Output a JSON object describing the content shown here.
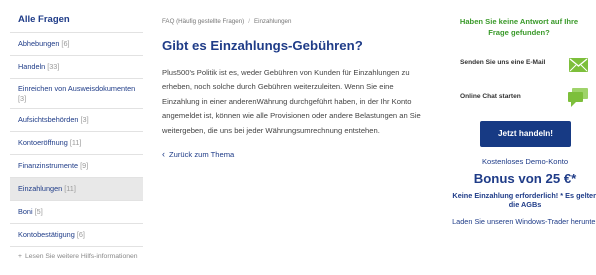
{
  "sidebar": {
    "title": "Alle Fragen",
    "items": [
      {
        "label": "Abhebungen",
        "count": "[6]"
      },
      {
        "label": "Handeln",
        "count": "[33]"
      },
      {
        "label": "Einreichen von Ausweisdokumenten",
        "count": "[3]"
      },
      {
        "label": "Aufsichtsbehörden",
        "count": "[3]"
      },
      {
        "label": "Kontoeröffnung",
        "count": "[11]"
      },
      {
        "label": "Finanzinstrumente",
        "count": "[9]"
      },
      {
        "label": "Einzahlungen",
        "count": "[11]"
      },
      {
        "label": "Boni",
        "count": "[5]"
      },
      {
        "label": "Kontobestätigung",
        "count": "[6]"
      }
    ],
    "more_label": "Lesen Sie weitere Hilfs-informationen"
  },
  "breadcrumb": {
    "root": "FAQ (Häufig gestellte Fragen)",
    "separator": "/",
    "current": "Einzahlungen"
  },
  "article": {
    "title": "Gibt es Einzahlungs-Gebühren?",
    "body": "Plus500's Politik ist es, weder Gebühren von Kunden für Einzahlungen zu erheben, noch solche durch Gebühren weiterzuleiten. Wenn Sie eine Einzahlung in einer anderenWährung durchgeführt haben, in der Ihr Konto angemeldet ist, können wie alle Provisionen oder andere Belastungen an Sie weitergeben, die uns bei jeder Währungsumrechnung entstehen.",
    "back_label": "Zurück zum Thema"
  },
  "help": {
    "question": "Haben Sie keine Antwort auf Ihre Frage gefunden?",
    "email_label": "Senden Sie uns eine E-Mail",
    "chat_label": "Online Chat starten",
    "cta_label": "Jetzt handeln!",
    "demo_label": "Kostenloses Demo-Konto",
    "bonus_label": "Bonus von 25 €*",
    "bonus_note": "Keine Einzahlung erforderlich! * Es gelten die AGBs",
    "trader_label": "Laden Sie unseren Windows-Trader herunter"
  },
  "colors": {
    "brand": "#1f3c88",
    "green": "#3a9a2a",
    "icon_green": "#7dbf3b",
    "active_bg": "#e8e8e8"
  },
  "icons": {
    "email": "envelope-icon",
    "chat": "chat-bubble-icon",
    "back": "chevron-left-icon",
    "more": "plus-icon"
  }
}
